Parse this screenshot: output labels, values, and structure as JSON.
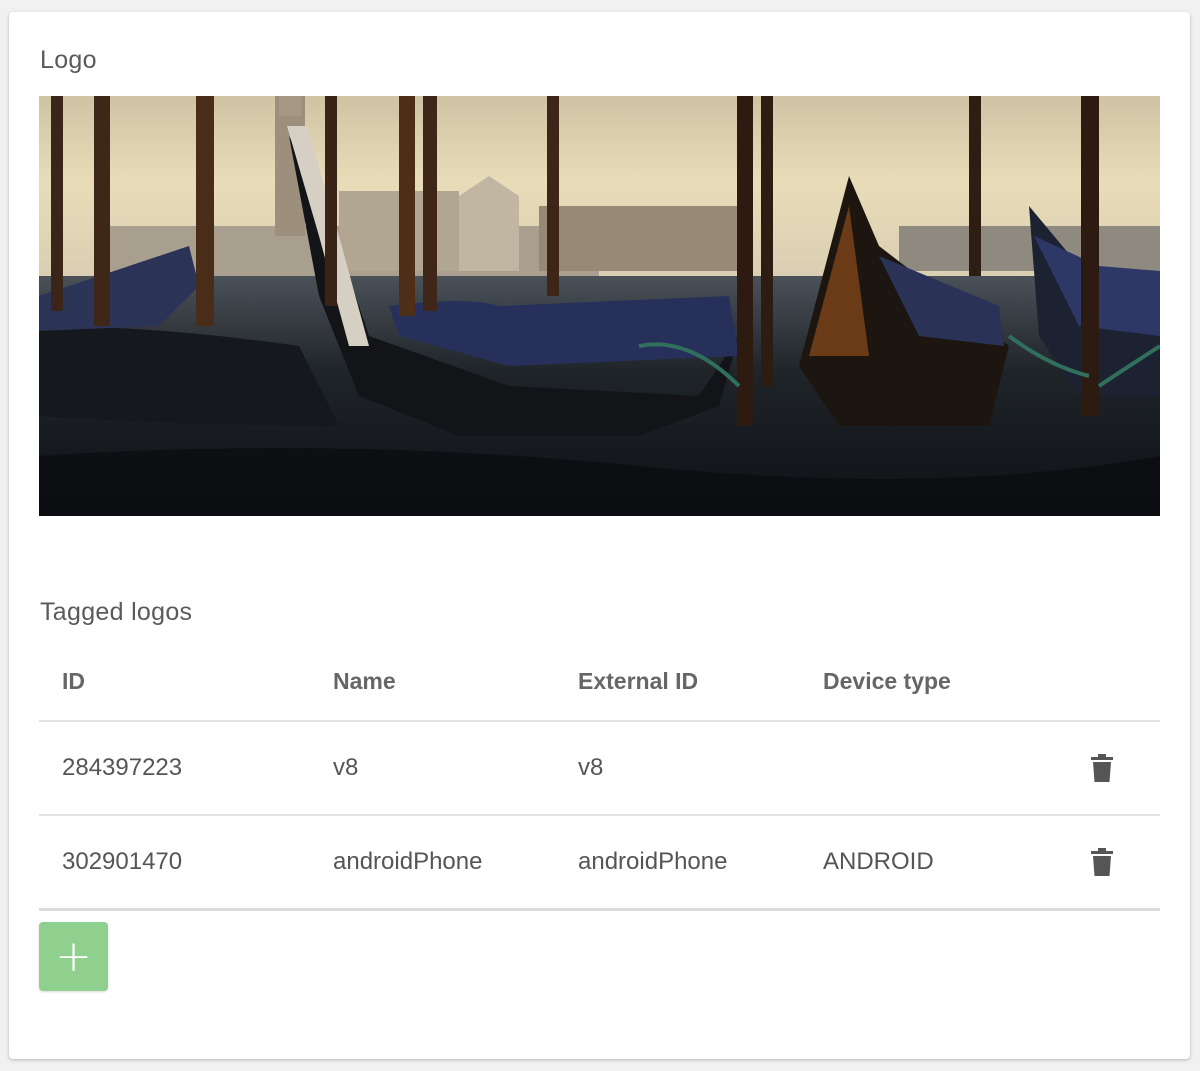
{
  "logo_section": {
    "title": "Logo",
    "image_icon": "logo-image"
  },
  "tagged_section": {
    "title": "Tagged logos",
    "columns": [
      "ID",
      "Name",
      "External ID",
      "Device type"
    ],
    "rows": [
      {
        "id": "284397223",
        "name": "v8",
        "external_id": "v8",
        "device_type": "",
        "action_icon": "trash-icon"
      },
      {
        "id": "302901470",
        "name": "androidPhone",
        "external_id": "androidPhone",
        "device_type": "ANDROID",
        "action_icon": "trash-icon"
      }
    ]
  },
  "add_button": {
    "label": "+",
    "icon": "plus-icon",
    "color": "#8fd08e"
  },
  "colors": {
    "card_background": "#ffffff",
    "page_background": "#f1f1f1",
    "text": "#555555",
    "divider": "#e2e2e2"
  }
}
